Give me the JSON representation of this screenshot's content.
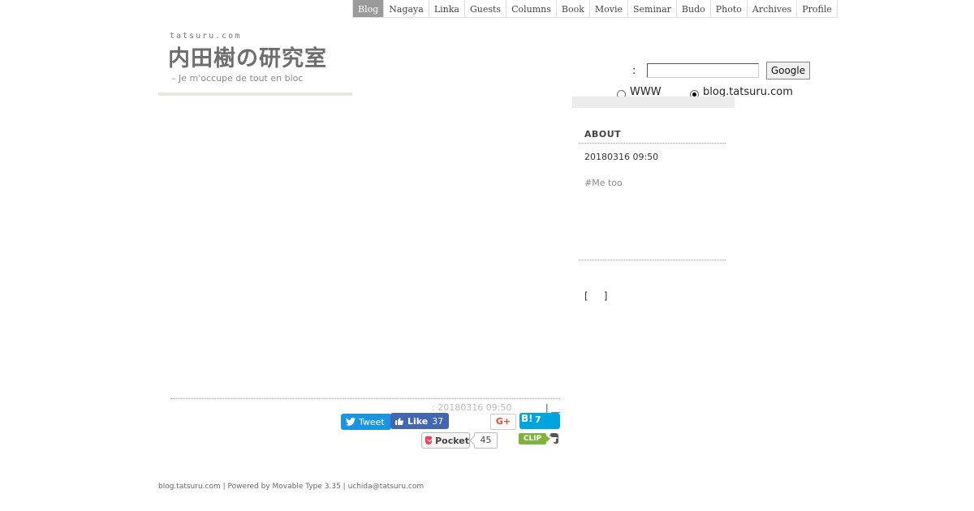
{
  "nav": {
    "tabs": [
      {
        "label": "Blog",
        "active": true
      },
      {
        "label": "Nagaya",
        "active": false
      },
      {
        "label": "Linka",
        "active": false
      },
      {
        "label": "Guests",
        "active": false
      },
      {
        "label": "Columns",
        "active": false
      },
      {
        "label": "Book",
        "active": false
      },
      {
        "label": "Movie",
        "active": false
      },
      {
        "label": "Seminar",
        "active": false
      },
      {
        "label": "Budo",
        "active": false
      },
      {
        "label": "Photo",
        "active": false
      },
      {
        "label": "Archives",
        "active": false
      },
      {
        "label": "Profile",
        "active": false
      }
    ],
    "active_color": "#9a9a9a"
  },
  "header": {
    "site_small": "tatsuru.com",
    "title": "内田樹の研究室",
    "tagline": "– Je m'occupe de tout en bloc"
  },
  "search": {
    "colon": ":",
    "input_value": "",
    "button_label": "Google",
    "options": [
      {
        "label": "WWW",
        "selected": false
      },
      {
        "label": "blog.tatsuru.com",
        "selected": true
      }
    ]
  },
  "sidebar": {
    "about_heading": "ABOUT",
    "about_date": "20180316 09:50",
    "about_link": "#Me too",
    "brackets": "[     ]"
  },
  "post": {
    "meta": ": 20180316 09:50",
    "meta_separator": "|",
    "meta_link": "__"
  },
  "share": {
    "tweet_label": "Tweet",
    "like_label": "Like",
    "like_count": "37",
    "gplus_label": "G+",
    "hatena_label": "B!",
    "hatena_count": "7",
    "pocket_label": "Pocket",
    "pocket_count": "45",
    "clip_label": "CLIP",
    "colors": {
      "twitter": "#1b95e0",
      "facebook": "#4267b2",
      "hatena": "#00a4de",
      "pocket": "#ef4056",
      "clip": "#7fb33e",
      "gplus": "#dd4b39"
    }
  },
  "footer": {
    "text": "blog.tatsuru.com | Powered by Movable Type 3.35 | uchida@tatsuru.com"
  }
}
